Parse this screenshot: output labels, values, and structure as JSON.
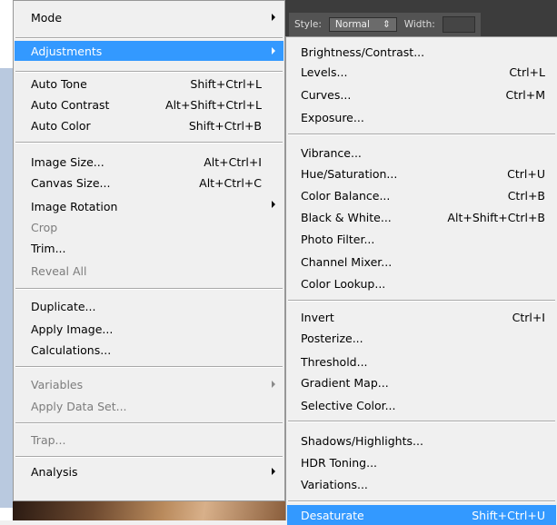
{
  "options_bar": {
    "style_label": "Style:",
    "style_value": "Normal",
    "width_label": "Width:"
  },
  "main_menu": [
    {
      "label": "Mode",
      "shortcut": "",
      "submenu": true,
      "disabled": false,
      "highlighted": false
    },
    {
      "label": "Adjustments",
      "shortcut": "",
      "submenu": true,
      "disabled": false,
      "highlighted": true
    },
    {
      "label": "Auto Tone",
      "shortcut": "Shift+Ctrl+L",
      "submenu": false,
      "disabled": false,
      "highlighted": false
    },
    {
      "label": "Auto Contrast",
      "shortcut": "Alt+Shift+Ctrl+L",
      "submenu": false,
      "disabled": false,
      "highlighted": false
    },
    {
      "label": "Auto Color",
      "shortcut": "Shift+Ctrl+B",
      "submenu": false,
      "disabled": false,
      "highlighted": false
    },
    {
      "label": "Image Size...",
      "shortcut": "Alt+Ctrl+I",
      "submenu": false,
      "disabled": false,
      "highlighted": false
    },
    {
      "label": "Canvas Size...",
      "shortcut": "Alt+Ctrl+C",
      "submenu": false,
      "disabled": false,
      "highlighted": false
    },
    {
      "label": "Image Rotation",
      "shortcut": "",
      "submenu": true,
      "disabled": false,
      "highlighted": false
    },
    {
      "label": "Crop",
      "shortcut": "",
      "submenu": false,
      "disabled": true,
      "highlighted": false
    },
    {
      "label": "Trim...",
      "shortcut": "",
      "submenu": false,
      "disabled": false,
      "highlighted": false
    },
    {
      "label": "Reveal All",
      "shortcut": "",
      "submenu": false,
      "disabled": true,
      "highlighted": false
    },
    {
      "label": "Duplicate...",
      "shortcut": "",
      "submenu": false,
      "disabled": false,
      "highlighted": false
    },
    {
      "label": "Apply Image...",
      "shortcut": "",
      "submenu": false,
      "disabled": false,
      "highlighted": false
    },
    {
      "label": "Calculations...",
      "shortcut": "",
      "submenu": false,
      "disabled": false,
      "highlighted": false
    },
    {
      "label": "Variables",
      "shortcut": "",
      "submenu": true,
      "disabled": true,
      "highlighted": false
    },
    {
      "label": "Apply Data Set...",
      "shortcut": "",
      "submenu": false,
      "disabled": true,
      "highlighted": false
    },
    {
      "label": "Trap...",
      "shortcut": "",
      "submenu": false,
      "disabled": true,
      "highlighted": false
    },
    {
      "label": "Analysis",
      "shortcut": "",
      "submenu": true,
      "disabled": false,
      "highlighted": false
    }
  ],
  "adjustments_menu": [
    {
      "label": "Brightness/Contrast...",
      "shortcut": "",
      "highlighted": false
    },
    {
      "label": "Levels...",
      "shortcut": "Ctrl+L",
      "highlighted": false
    },
    {
      "label": "Curves...",
      "shortcut": "Ctrl+M",
      "highlighted": false
    },
    {
      "label": "Exposure...",
      "shortcut": "",
      "highlighted": false
    },
    {
      "label": "Vibrance...",
      "shortcut": "",
      "highlighted": false
    },
    {
      "label": "Hue/Saturation...",
      "shortcut": "Ctrl+U",
      "highlighted": false
    },
    {
      "label": "Color Balance...",
      "shortcut": "Ctrl+B",
      "highlighted": false
    },
    {
      "label": "Black & White...",
      "shortcut": "Alt+Shift+Ctrl+B",
      "highlighted": false
    },
    {
      "label": "Photo Filter...",
      "shortcut": "",
      "highlighted": false
    },
    {
      "label": "Channel Mixer...",
      "shortcut": "",
      "highlighted": false
    },
    {
      "label": "Color Lookup...",
      "shortcut": "",
      "highlighted": false
    },
    {
      "label": "Invert",
      "shortcut": "Ctrl+I",
      "highlighted": false
    },
    {
      "label": "Posterize...",
      "shortcut": "",
      "highlighted": false
    },
    {
      "label": "Threshold...",
      "shortcut": "",
      "highlighted": false
    },
    {
      "label": "Gradient Map...",
      "shortcut": "",
      "highlighted": false
    },
    {
      "label": "Selective Color...",
      "shortcut": "",
      "highlighted": false
    },
    {
      "label": "Shadows/Highlights...",
      "shortcut": "",
      "highlighted": false
    },
    {
      "label": "HDR Toning...",
      "shortcut": "",
      "highlighted": false
    },
    {
      "label": "Variations...",
      "shortcut": "",
      "highlighted": false
    },
    {
      "label": "Desaturate",
      "shortcut": "Shift+Ctrl+U",
      "highlighted": true
    }
  ],
  "colors": {
    "highlight": "#3399ff",
    "menu_bg": "#f0f0f0",
    "disabled_text": "#7c7c7c"
  }
}
